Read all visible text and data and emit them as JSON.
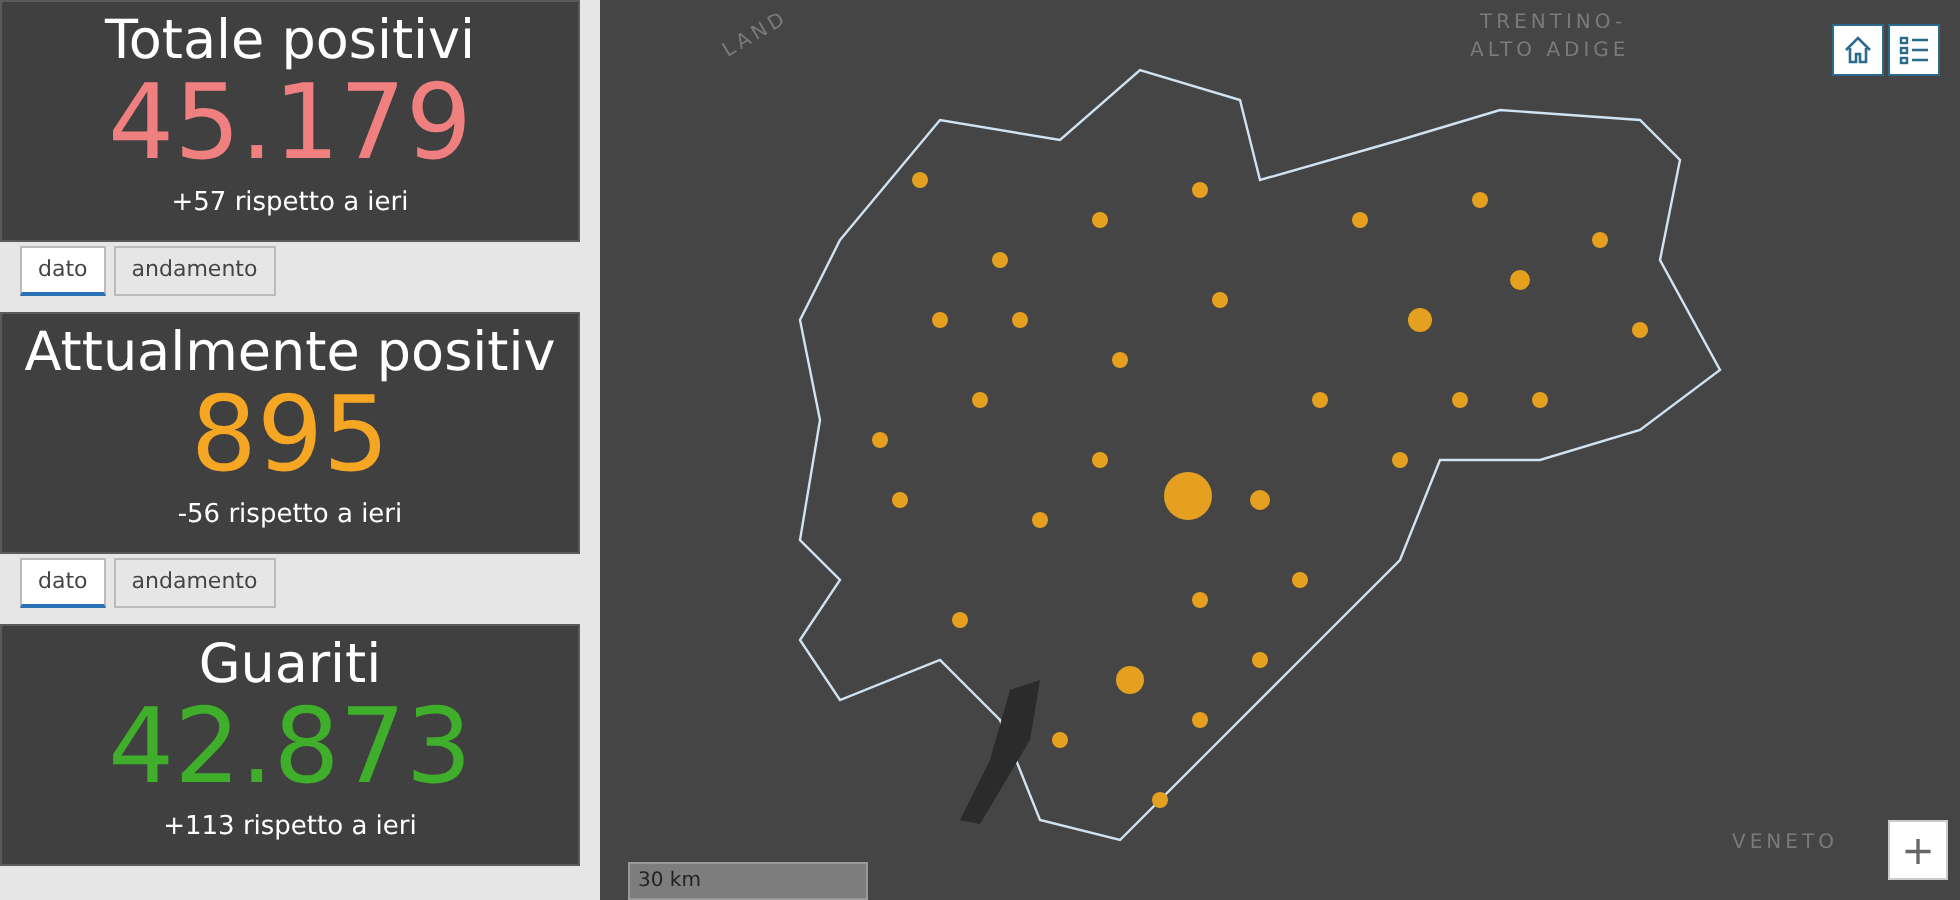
{
  "indicators": [
    {
      "title": "Totale positivi",
      "value": "45.179",
      "color": "#f08080",
      "change": "+57 rispetto a ieri",
      "tabs": [
        {
          "label": "dato",
          "selected": true
        },
        {
          "label": "andamento",
          "selected": false
        }
      ]
    },
    {
      "title": "Attualmente positiv",
      "value": "895",
      "color": "#f5a623",
      "change": "-56 rispetto a ieri",
      "tabs": [
        {
          "label": "dato",
          "selected": true
        },
        {
          "label": "andamento",
          "selected": false
        }
      ]
    },
    {
      "title": "Guariti",
      "value": "42.873",
      "color": "#3fae2a",
      "change": "+113 rispetto a ieri"
    }
  ],
  "map": {
    "labels": [
      {
        "text": "LAND",
        "kind": "country"
      },
      {
        "text": "TRENTINO-",
        "kind": "region"
      },
      {
        "text": "ALTO ADIGE",
        "kind": "region"
      },
      {
        "text": "VENETO",
        "kind": "region"
      }
    ],
    "scale": "30 km",
    "zoom_in": "+"
  }
}
